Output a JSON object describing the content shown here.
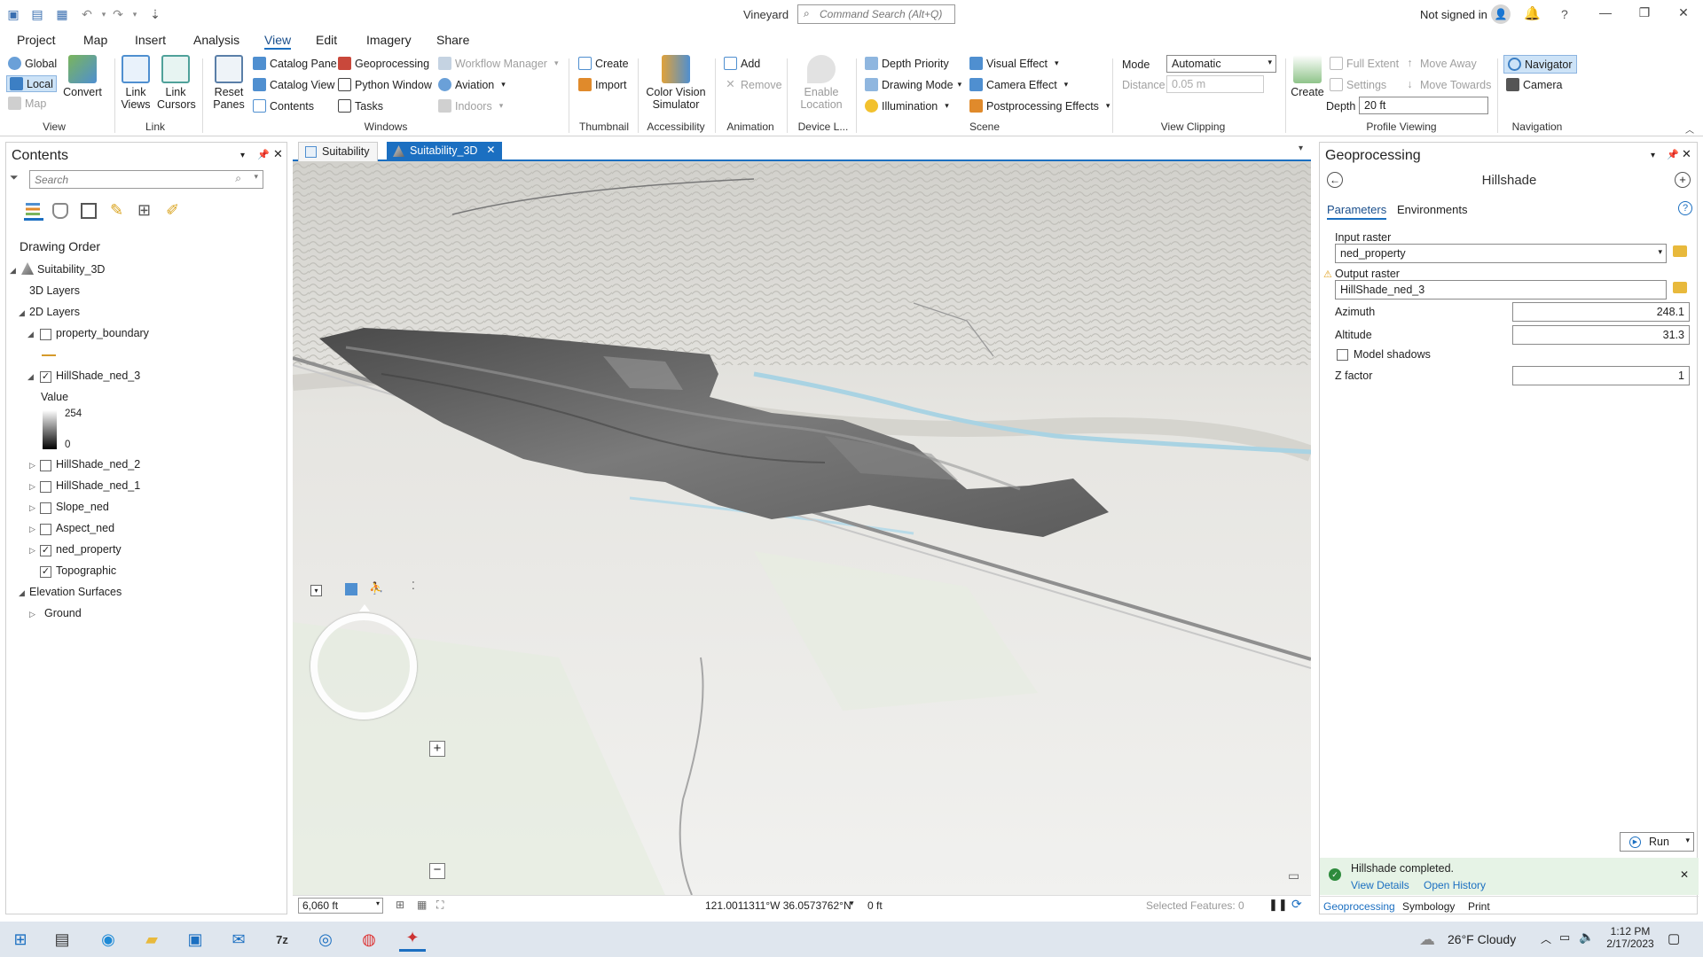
{
  "title": {
    "app_name": "Vineyard",
    "command_search_placeholder": "Command Search (Alt+Q)",
    "sign_in": "Not signed in"
  },
  "menu_tabs": [
    "Project",
    "Map",
    "Insert",
    "Analysis",
    "View",
    "Edit",
    "Imagery",
    "Share"
  ],
  "active_tab": "View",
  "ribbon": {
    "view": {
      "global": "Global",
      "local": "Local",
      "convert": "Convert",
      "map": "Map",
      "label": "View"
    },
    "link": {
      "link_views": "Link",
      "link_views2": "Views",
      "link_cursors": "Link",
      "link_cursors2": "Cursors",
      "label": "Link"
    },
    "windows": {
      "reset_panes": "Reset",
      "reset_panes2": "Panes",
      "catalog_pane": "Catalog Pane",
      "catalog_view": "Catalog View",
      "contents": "Contents",
      "geoprocessing": "Geoprocessing",
      "python_window": "Python Window",
      "tasks": "Tasks",
      "workflow_manager": "Workflow Manager",
      "aviation": "Aviation",
      "indoors": "Indoors",
      "label": "Windows"
    },
    "thumbnail": {
      "create": "Create",
      "import": "Import",
      "label": "Thumbnail"
    },
    "accessibility": {
      "color_vision": "Color Vision",
      "color_vision2": "Simulator",
      "label": "Accessibility"
    },
    "animation": {
      "add": "Add",
      "remove": "Remove",
      "label": "Animation"
    },
    "device": {
      "enable_location": "Enable",
      "enable_location2": "Location",
      "label": "Device L..."
    },
    "scene": {
      "depth_priority": "Depth Priority",
      "drawing_mode": "Drawing Mode",
      "illumination": "Illumination",
      "visual_effect": "Visual Effect",
      "camera_effect": "Camera Effect",
      "postprocessing": "Postprocessing Effects",
      "label": "Scene"
    },
    "view_clipping": {
      "mode_label": "Mode",
      "mode_value": "Automatic",
      "distance_label": "Distance",
      "distance_value": "0.05 m",
      "label": "View Clipping"
    },
    "profile": {
      "create": "Create",
      "full_extent": "Full Extent",
      "settings": "Settings",
      "move_away": "Move Away",
      "move_towards": "Move Towards",
      "depth_label": "Depth",
      "depth_value": "20 ft",
      "label": "Profile Viewing"
    },
    "navigation": {
      "navigator": "Navigator",
      "camera": "Camera",
      "label": "Navigation"
    }
  },
  "contents": {
    "title": "Contents",
    "search_placeholder": "Search",
    "drawing_order": "Drawing Order",
    "items": {
      "scene": "Suitability_3D",
      "layers3d": "3D Layers",
      "layers2d": "2D Layers",
      "property_boundary": "property_boundary",
      "hillshade3": "HillShade_ned_3",
      "value_label": "Value",
      "value_max": "254",
      "value_min": "0",
      "hillshade2": "HillShade_ned_2",
      "hillshade1": "HillShade_ned_1",
      "slope": "Slope_ned",
      "aspect": "Aspect_ned",
      "ned_property": "ned_property",
      "topographic": "Topographic",
      "elevation": "Elevation Surfaces",
      "ground": "Ground"
    }
  },
  "view_tabs": {
    "tab1": "Suitability",
    "tab2": "Suitability_3D"
  },
  "map_status": {
    "scale": "6,060 ft",
    "coords": "121.0011311°W 36.0573762°N",
    "elev": "0 ft",
    "selected": "Selected Features: 0"
  },
  "geoprocessing": {
    "title": "Geoprocessing",
    "tool": "Hillshade",
    "tab_params": "Parameters",
    "tab_env": "Environments",
    "input_raster_label": "Input raster",
    "input_raster_value": "ned_property",
    "output_raster_label": "Output raster",
    "output_raster_value": "HillShade_ned_3",
    "azimuth_label": "Azimuth",
    "azimuth_value": "248.1",
    "altitude_label": "Altitude",
    "altitude_value": "31.3",
    "model_shadows": "Model shadows",
    "zfactor_label": "Z factor",
    "zfactor_value": "1",
    "run": "Run",
    "status_message": "Hillshade completed.",
    "view_details": "View Details",
    "open_history": "Open History",
    "bottom_tabs": [
      "Geoprocessing",
      "Symbology",
      "Print"
    ]
  },
  "taskbar": {
    "weather": "26°F  Cloudy",
    "time": "1:12 PM",
    "date": "2/17/2023"
  },
  "colors": {
    "accent": "#1b6fc1",
    "taskbar": "#dfe6ee",
    "success": "#2e8b3d"
  }
}
